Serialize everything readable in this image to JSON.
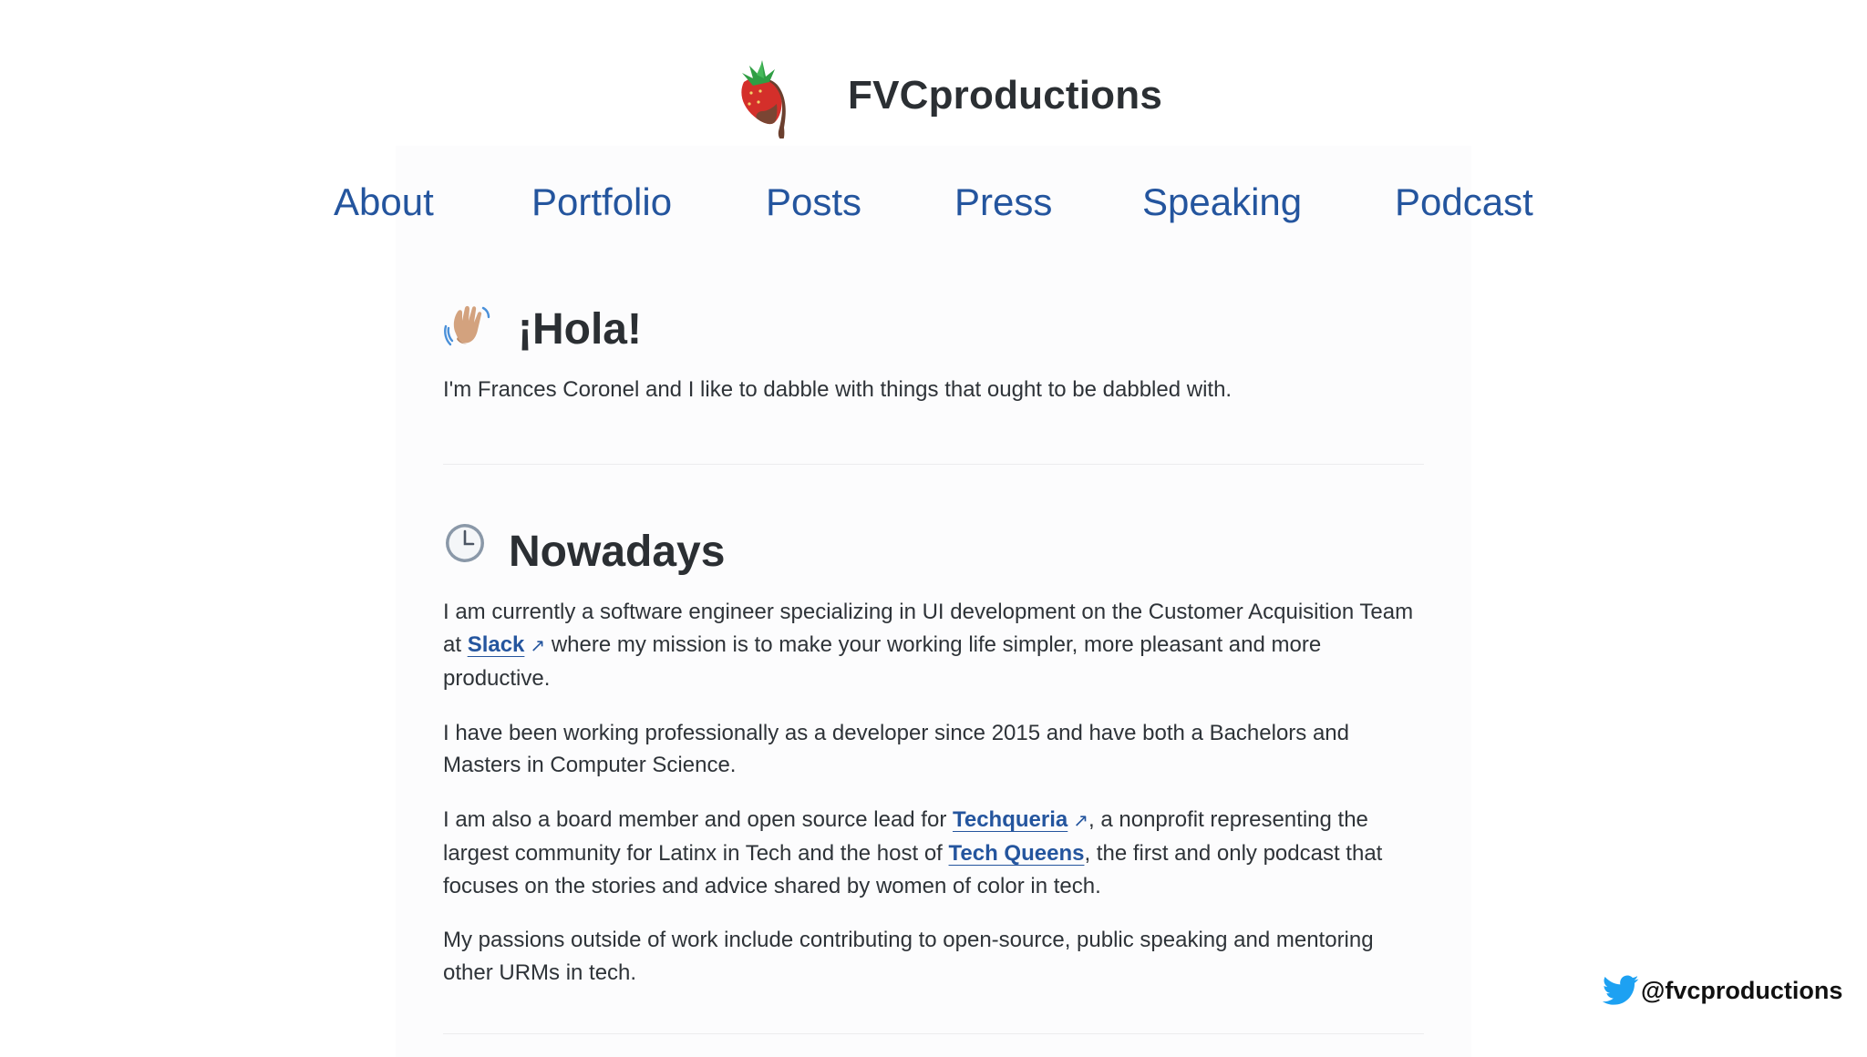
{
  "site": {
    "title": "FVCproductions",
    "logo_icon": "strawberry-icon"
  },
  "nav": {
    "items": [
      {
        "label": "About"
      },
      {
        "label": "Portfolio"
      },
      {
        "label": "Posts"
      },
      {
        "label": "Press"
      },
      {
        "label": "Speaking"
      },
      {
        "label": "Podcast"
      }
    ]
  },
  "hola": {
    "icon": "waving-hand-icon",
    "title": "¡Hola!",
    "text": "I'm Frances Coronel and I like to dabble with things that ought to be dabbled with."
  },
  "nowadays": {
    "icon": "clock-icon",
    "title": "Nowadays",
    "p1": {
      "before": "I am currently a software engineer specializing in UI development on the Customer Acquisition Team at ",
      "link": "Slack",
      "after": " where my mission is to make your working life simpler, more pleasant and more productive."
    },
    "p2": "I have been working professionally as a developer since 2015 and have both a Bachelors and Masters in Computer Science.",
    "p3": {
      "before": "I am also a board member and open source lead for ",
      "link1": "Techqueria",
      "middle": ", a nonprofit representing the largest community for Latinx in Tech and the host of ",
      "link2": "Tech Queens",
      "after": ", the first and only podcast that focuses on the stories and advice shared by women of color in tech."
    },
    "p4": "My passions outside of work include contributing to open-source, public speaking and mentoring other URMs in tech."
  },
  "external_link_glyph": "↗",
  "twitter": {
    "icon": "twitter-bird-icon",
    "handle": "@fvcproductions"
  },
  "colors": {
    "link": "#24559e",
    "text": "#2e3338",
    "twitter": "#1da1f2"
  }
}
